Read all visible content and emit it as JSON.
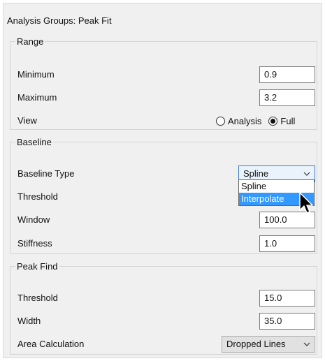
{
  "title": "Analysis Groups: Peak Fit",
  "range": {
    "legend": "Range",
    "minimum_label": "Minimum",
    "minimum_value": "0.9",
    "maximum_label": "Maximum",
    "maximum_value": "3.2",
    "view_label": "View",
    "view_options": [
      {
        "label": "Analysis",
        "selected": false
      },
      {
        "label": "Full",
        "selected": true
      }
    ]
  },
  "baseline": {
    "legend": "Baseline",
    "type_label": "Baseline Type",
    "type_value": "Spline",
    "type_options": [
      "Spline",
      "Interpolate"
    ],
    "highlighted_option": "Interpolate",
    "threshold_label": "Threshold",
    "window_label": "Window",
    "window_value": "100.0",
    "stiffness_label": "Stiffness",
    "stiffness_value": "1.0"
  },
  "peak_find": {
    "legend": "Peak Find",
    "threshold_label": "Threshold",
    "threshold_value": "15.0",
    "width_label": "Width",
    "width_value": "35.0",
    "area_label": "Area Calculation",
    "area_value": "Dropped Lines"
  },
  "icons": {
    "chevron": "chevron-down-icon",
    "cursor": "mouse-pointer-icon"
  },
  "colors": {
    "highlight": "#3399ff",
    "focus_border": "#3d7bc9"
  }
}
